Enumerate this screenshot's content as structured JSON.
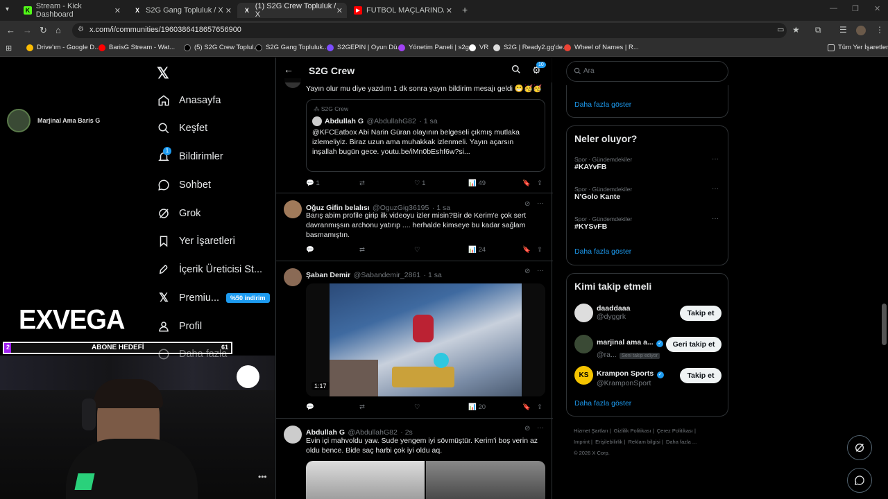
{
  "tabs": [
    {
      "title": "Stream - Kick Dashboard",
      "favicon": "K"
    },
    {
      "title": "S2G Gang Topluluk / X",
      "favicon": "X"
    },
    {
      "title": "(1) S2G Crew Topluluk / X",
      "favicon": "X"
    },
    {
      "title": "FUTBOL MAÇLARINDA YAŞAN...",
      "favicon": "▶"
    }
  ],
  "url": "x.com/i/communities/1960386418657656900",
  "bookmarks": [
    "Drive'ım - Google D...",
    "BarisG Stream - Wat...",
    "(5) S2G Crew Toplul...",
    "S2G Gang Topluluk...",
    "S2GEPIN | Oyun Dü...",
    "Yönetim Paneli | s2g...",
    "VR",
    "S2G | Ready2.gg'de...",
    "Wheel of Names | R...",
    "Tüm Yer İşaretleri"
  ],
  "stream": {
    "streamer_name": "Marjinal Ama Baris G",
    "logo": "EXVEGA",
    "goal_label": "ABONE HEDEFİ",
    "goal_current": "2",
    "goal_target": "61"
  },
  "nav": {
    "items": [
      "Anasayfa",
      "Keşfet",
      "Bildirimler",
      "Sohbet",
      "Grok",
      "Yer İşaretleri",
      "İçerik Üreticisi St...",
      "Premiu...",
      "Profil",
      "Daha fazla"
    ],
    "notif_badge": "1",
    "premium_badge": "%50 indirim"
  },
  "header": {
    "title": "S2G Crew",
    "settings_badge": "10"
  },
  "tweets": [
    {
      "text": "Yayın olur mu diye yazdım 1 dk sonra yayın bildirim mesajı geldi 😁🥳🥳",
      "quote": {
        "community": "S2G Crew",
        "name": "Abdullah G",
        "handle": "@AbdullahG82",
        "time": "· 1 sa",
        "text": "@KFCEatbox Abi Narin Güran olayının belgeseli çıkmış mutlaka izlemeliyiz. Biraz uzun ama muhakkak izlenmeli. Yayın açarsın inşallah bugün gece. youtu.be/iMn0bEshf6w?si..."
      },
      "replies": "1",
      "likes": "1",
      "views": "49"
    },
    {
      "name": "Oğuz Gifin belalısı",
      "handle": "@OguzGig36195",
      "time": "· 1 sa",
      "text": "Barış abim profile girip ilk videoyu izler misin?Bir de Kerim'e çok sert davranmışsın archonu yatırıp .... herhalde kimseye bu kadar sağlam basmamıştın.",
      "views": "24"
    },
    {
      "name": "Şaban Demir",
      "handle": "@Sabandemir_2861",
      "time": "· 1 sa",
      "video_time": "1:17",
      "views": "20"
    },
    {
      "name": "Abdullah G",
      "handle": "@AbdullahG82",
      "time": "· 2s",
      "text": "Evin içi mahvoldu yaw. Sude yengem iyi sövmüştür. Kerim'i boş verin az oldu bence. Bide saç harbi çok iyi oldu aq."
    }
  ],
  "search": {
    "placeholder": "Ara"
  },
  "right": {
    "show_more": "Daha fazla göster",
    "trends_title": "Neler oluyor?",
    "trends": [
      {
        "category": "Spor · Gündemdekiler",
        "name": "#KAYvFB"
      },
      {
        "category": "Spor · Gündemdekiler",
        "name": "N'Golo Kante"
      },
      {
        "category": "Spor · Gündemdekiler",
        "name": "#KYSvFB"
      }
    ],
    "follow_title": "Kimi takip etmeli",
    "follow": [
      {
        "name": "daaddaaa",
        "handle": "@dyggrk",
        "button": "Takip et"
      },
      {
        "name": "marjinal ama a...",
        "handle": "@ra...",
        "sub_badge": "Seni takip ediyor",
        "button": "Geri takip et"
      },
      {
        "name": "Krampon Sports",
        "handle": "@KramponSport",
        "button": "Takip et"
      }
    ],
    "footer": [
      "Hizmet Şartları",
      "Gizlilik Politikası",
      "Çerez Politikası",
      "Imprint",
      "Erişilebilirlik",
      "Reklam bilgisi",
      "Daha fazla ...",
      "© 2026 X Corp."
    ]
  },
  "colors": {
    "accent": "#1d9bf0",
    "kick_green": "#53fc18",
    "premium_badge": "#1d9bf0",
    "notif_badge": "#1d9bf0",
    "verified": "#1d9bf0"
  }
}
